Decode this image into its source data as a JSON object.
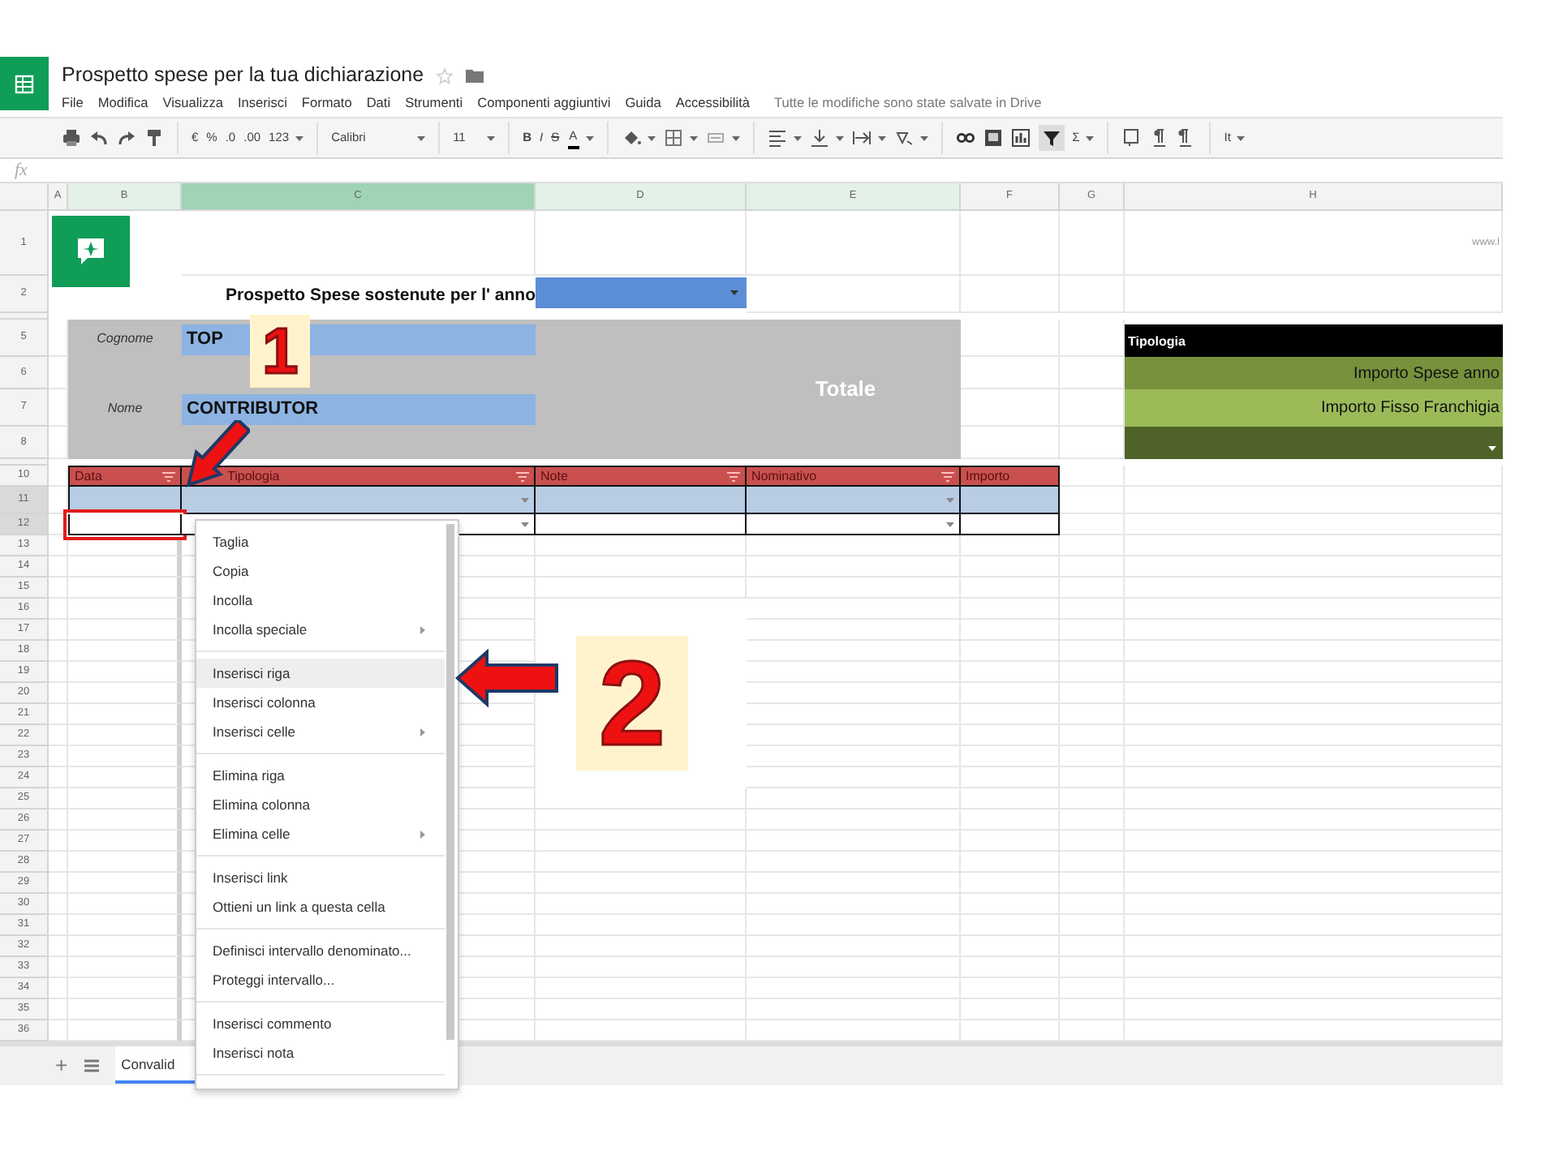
{
  "app": {
    "title": "Prospetto spese per la tua dichiarazione",
    "menu": [
      "File",
      "Modifica",
      "Visualizza",
      "Inserisci",
      "Formato",
      "Dati",
      "Strumenti",
      "Componenti aggiuntivi",
      "Guida",
      "Accessibilità"
    ],
    "save_status": "Tutte le modifiche sono state salvate in Drive"
  },
  "toolbar": [
    {
      "kind": "print"
    },
    {
      "kind": "undo"
    },
    {
      "kind": "redo"
    },
    {
      "kind": "paint"
    },
    {
      "kind": "divider"
    },
    {
      "kind": "text",
      "label": "€"
    },
    {
      "kind": "text",
      "label": "%"
    },
    {
      "kind": "text",
      "label": ".0"
    },
    {
      "kind": "text",
      "label": ".00"
    },
    {
      "kind": "menu",
      "label": "123"
    },
    {
      "kind": "divider"
    },
    {
      "kind": "font",
      "label": "Calibri"
    },
    {
      "kind": "divider"
    },
    {
      "kind": "size",
      "label": "11"
    },
    {
      "kind": "divider"
    },
    {
      "kind": "bold",
      "label": "B"
    },
    {
      "kind": "italic",
      "label": "I"
    },
    {
      "kind": "strike",
      "label": "S"
    },
    {
      "kind": "color",
      "label": "A"
    },
    {
      "kind": "divider"
    },
    {
      "kind": "fill"
    },
    {
      "kind": "borders"
    },
    {
      "kind": "merge"
    },
    {
      "kind": "divider"
    },
    {
      "kind": "halign"
    },
    {
      "kind": "valign"
    },
    {
      "kind": "wrap"
    },
    {
      "kind": "rotate"
    },
    {
      "kind": "divider"
    },
    {
      "kind": "link"
    },
    {
      "kind": "comment"
    },
    {
      "kind": "chart"
    },
    {
      "kind": "filter"
    },
    {
      "kind": "menu",
      "label": "Σ"
    },
    {
      "kind": "divider"
    },
    {
      "kind": "note"
    },
    {
      "kind": "ltr"
    },
    {
      "kind": "rtl"
    },
    {
      "kind": "divider"
    },
    {
      "kind": "menu",
      "label": "It"
    }
  ],
  "formula_bar": {
    "label": "fx"
  },
  "columns": [
    {
      "label": "A",
      "selected": false,
      "in_selection": false
    },
    {
      "label": "B",
      "selected": false,
      "in_selection": true
    },
    {
      "label": "C",
      "selected": true,
      "in_selection": true
    },
    {
      "label": "D",
      "selected": false,
      "in_selection": true
    },
    {
      "label": "E",
      "selected": false,
      "in_selection": true
    },
    {
      "label": "F",
      "selected": false,
      "in_selection": false
    },
    {
      "label": "G",
      "selected": false,
      "in_selection": false
    },
    {
      "label": "H",
      "selected": false,
      "in_selection": false
    }
  ],
  "rows": [
    {
      "label": "1",
      "selected": false
    },
    {
      "label": "2",
      "selected": false
    },
    {
      "label": "5",
      "selected": false
    },
    {
      "label": "6",
      "selected": false
    },
    {
      "label": "7",
      "selected": false
    },
    {
      "label": "8",
      "selected": false
    },
    {
      "label": "10",
      "selected": false
    },
    {
      "label": "11",
      "selected": true
    },
    {
      "label": "12",
      "selected": true
    },
    {
      "label": "13",
      "selected": false
    },
    {
      "label": "14",
      "selected": false
    },
    {
      "label": "15",
      "selected": false
    },
    {
      "label": "16",
      "selected": false
    },
    {
      "label": "17",
      "selected": false
    },
    {
      "label": "18",
      "selected": false
    },
    {
      "label": "19",
      "selected": false
    },
    {
      "label": "20",
      "selected": false
    },
    {
      "label": "21",
      "selected": false
    },
    {
      "label": "22",
      "selected": false
    },
    {
      "label": "23",
      "selected": false
    },
    {
      "label": "24",
      "selected": false
    },
    {
      "label": "25",
      "selected": false
    },
    {
      "label": "26",
      "selected": false
    },
    {
      "label": "27",
      "selected": false
    },
    {
      "label": "28",
      "selected": false
    },
    {
      "label": "29",
      "selected": false
    },
    {
      "label": "30",
      "selected": false
    },
    {
      "label": "31",
      "selected": false
    },
    {
      "label": "32",
      "selected": false
    },
    {
      "label": "33",
      "selected": false
    },
    {
      "label": "34",
      "selected": false
    },
    {
      "label": "35",
      "selected": false
    },
    {
      "label": "36",
      "selected": false
    }
  ],
  "sheet": {
    "website": "www.l",
    "heading": "Prospetto Spese sostenute per l' anno",
    "surname_label": "Cognome",
    "surname": "TOP",
    "name_label": "Nome",
    "name": "CONTRIBUTOR",
    "total_label": "Totale",
    "type_panel": {
      "title": "Tipologia",
      "options": [
        "Importo Spese anno",
        "Importo Fisso Franchigia"
      ]
    }
  },
  "expense_table": {
    "columns": [
      {
        "label": "Data",
        "filter": true,
        "dropdown": false
      },
      {
        "label": "Tipologia",
        "filter": true,
        "dropdown": true
      },
      {
        "label": "Note",
        "filter": true,
        "dropdown": false
      },
      {
        "label": "Nominativo",
        "filter": true,
        "dropdown": true
      },
      {
        "label": "Importo",
        "filter": false,
        "dropdown": false
      }
    ],
    "rows": [
      {
        "shaded": true
      },
      {
        "shaded": false
      }
    ]
  },
  "context_menu": {
    "groups": [
      {
        "items": [
          {
            "label": "Taglia",
            "highlighted": false,
            "submenu": false
          },
          {
            "label": "Copia",
            "highlighted": false,
            "submenu": false
          },
          {
            "label": "Incolla",
            "highlighted": false,
            "submenu": false
          },
          {
            "label": "Incolla speciale",
            "highlighted": false,
            "submenu": true
          }
        ]
      },
      {
        "items": [
          {
            "label": "Inserisci riga",
            "highlighted": true,
            "submenu": false
          },
          {
            "label": "Inserisci colonna",
            "highlighted": false,
            "submenu": false
          },
          {
            "label": "Inserisci celle",
            "highlighted": false,
            "submenu": true
          }
        ]
      },
      {
        "items": [
          {
            "label": "Elimina riga",
            "highlighted": false,
            "submenu": false
          },
          {
            "label": "Elimina colonna",
            "highlighted": false,
            "submenu": false
          },
          {
            "label": "Elimina celle",
            "highlighted": false,
            "submenu": true
          }
        ]
      },
      {
        "items": [
          {
            "label": "Inserisci link",
            "highlighted": false,
            "submenu": false
          },
          {
            "label": "Ottieni un link a questa cella",
            "highlighted": false,
            "submenu": false
          }
        ]
      },
      {
        "items": [
          {
            "label": "Definisci intervallo denominato...",
            "highlighted": false,
            "submenu": false
          },
          {
            "label": "Proteggi intervallo...",
            "highlighted": false,
            "submenu": false
          }
        ]
      },
      {
        "items": [
          {
            "label": "Inserisci commento",
            "highlighted": false,
            "submenu": false
          },
          {
            "label": "Inserisci nota",
            "highlighted": false,
            "submenu": false
          }
        ]
      }
    ]
  },
  "bottom_bar": {
    "add_label": "+",
    "sheet_tabs": [
      {
        "label": "Convalid",
        "selected": true
      }
    ]
  },
  "annotations": [
    "1",
    "2"
  ]
}
